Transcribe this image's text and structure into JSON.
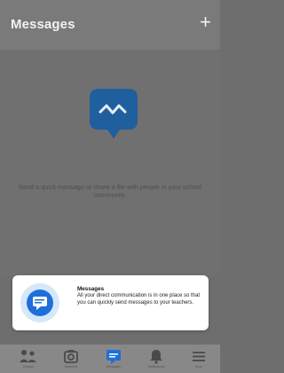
{
  "header": {
    "title": "Messages",
    "add_symbol": "+"
  },
  "empty_state": {
    "icon": "chat-bubble-icon",
    "text": "Send a quick message or share a file with people in your school community."
  },
  "onboarding_card": {
    "icon": "message-icon",
    "title": "Messages",
    "body": "All your direct communication is in one place so that you can quickly send messages to your teachers."
  },
  "bottom_nav": {
    "items": [
      {
        "label": "Classes",
        "icon": "people-icon"
      },
      {
        "label": "Moments",
        "icon": "camera-icon"
      },
      {
        "label": "Messages",
        "icon": "message-icon",
        "active": true
      },
      {
        "label": "Notifications",
        "icon": "bell-icon"
      },
      {
        "label": "More",
        "icon": "menu-icon"
      }
    ]
  },
  "colors": {
    "accent": "#1e6fd9",
    "header": "#7a7a7a",
    "overlay": "#6e6e6e",
    "empty_icon": "#1f5f9e"
  }
}
